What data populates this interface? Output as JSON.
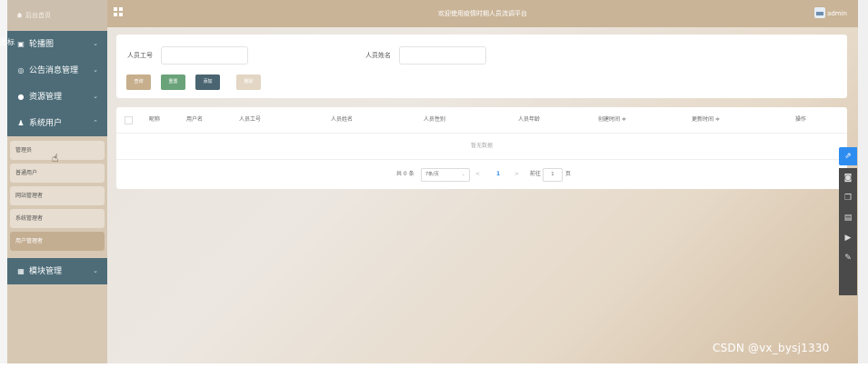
{
  "sidebar": {
    "home_label": "后台首页",
    "overlap_label": "图标",
    "menus": [
      {
        "icon": "image-icon",
        "label": "轮播图"
      },
      {
        "icon": "info-circle-icon",
        "label": "公告消息管理"
      },
      {
        "icon": "drop-icon",
        "label": "资源管理"
      },
      {
        "icon": "user-icon",
        "label": "系统用户"
      }
    ],
    "sub_items": [
      "管理员",
      "普通用户",
      "网站管理者",
      "系统管理者",
      "用户管理者"
    ],
    "last_menu": {
      "icon": "grid-icon",
      "label": "模块管理"
    }
  },
  "topbar": {
    "title": "欢迎使用疫情时期人员流调平台",
    "user": "admin"
  },
  "search": {
    "field1_label": "人员工号",
    "field2_label": "人员姓名",
    "buttons": {
      "query": "查询",
      "reset": "重置",
      "add": "添加",
      "delete": "删除"
    }
  },
  "table": {
    "columns": [
      "昵称",
      "用户名",
      "人员工号",
      "人员姓名",
      "人员性别",
      "人员年龄",
      "创建时间 ≑",
      "更新时间 ≑",
      "操作"
    ],
    "empty_text": "暂无数据"
  },
  "pagination": {
    "total": "共 0 条",
    "page_size": "7条/页",
    "prev": "<",
    "current_page": "1",
    "next": ">",
    "goto_label": "前往",
    "goto_value": "1",
    "page_unit": "页"
  },
  "watermark": "CSDN @vx_bysj1330",
  "colors": {
    "sidebar": "#d7c8b4",
    "menu_dark": "#4d6c78",
    "topbar": "#c9b497",
    "query_btn": "#c7ae8c",
    "reset_btn": "#6aa37a",
    "add_btn": "#4a6571",
    "delete_btn": "#e3d6c4",
    "accent_blue": "#2d8cf0"
  }
}
